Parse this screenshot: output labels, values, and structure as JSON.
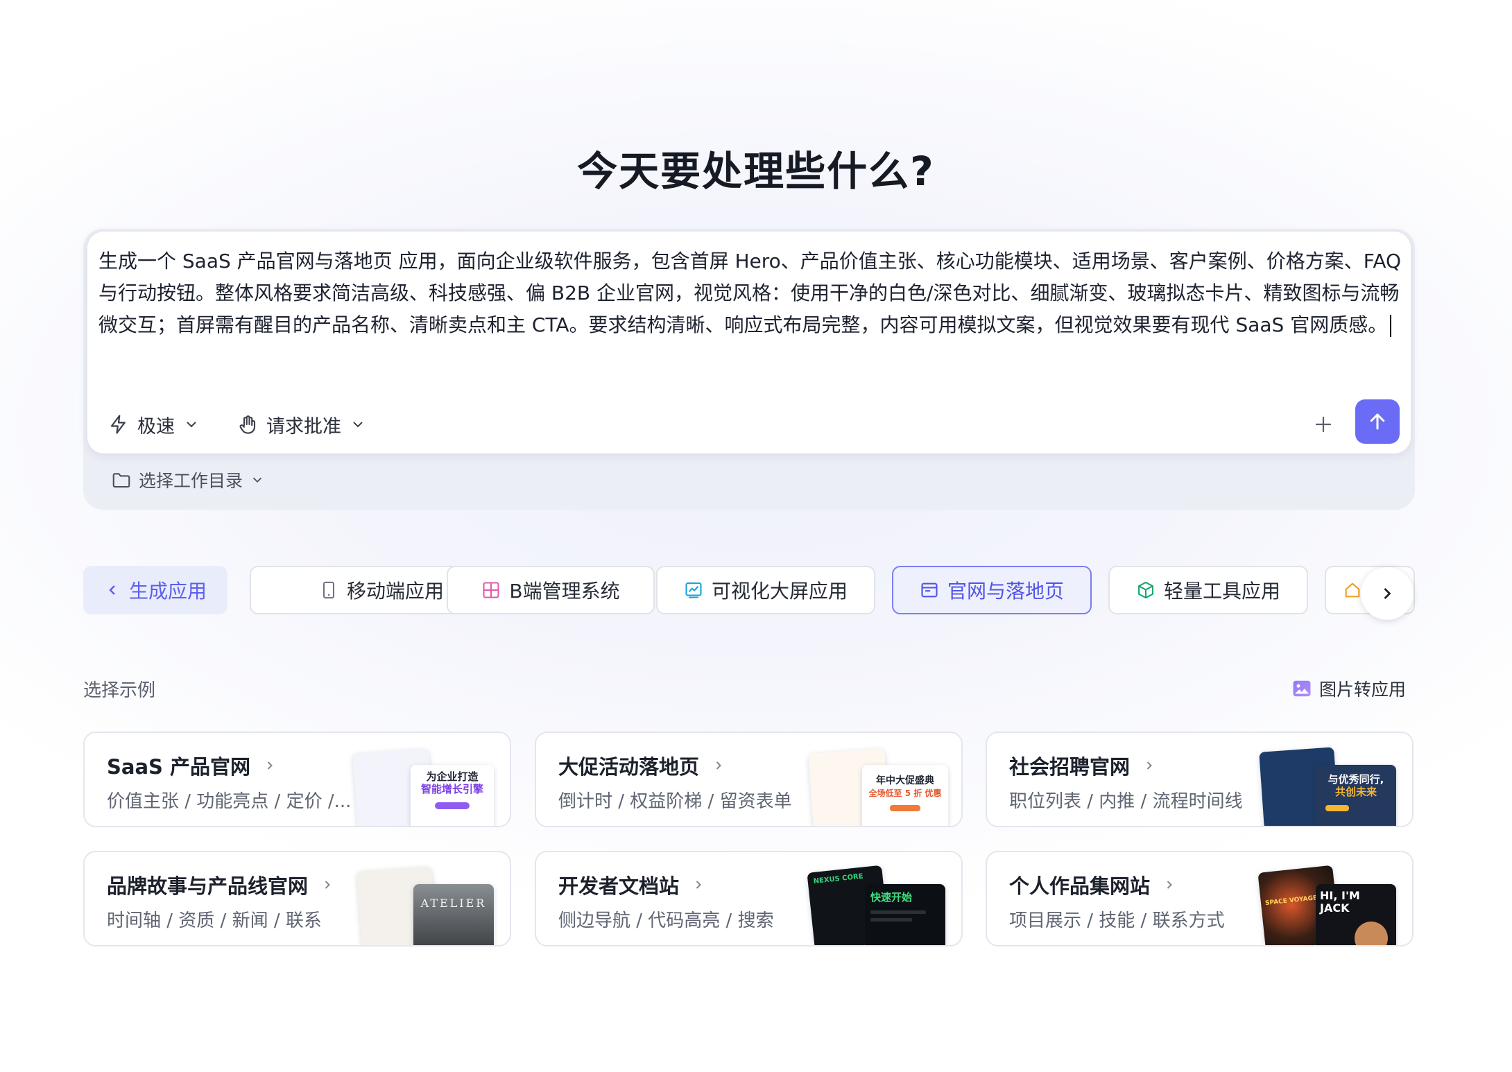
{
  "heading": "今天要处理些什么?",
  "composer": {
    "prompt": "生成一个 SaaS 产品官网与落地页 应用，面向企业级软件服务，包含首屏 Hero、产品价值主张、核心功能模块、适用场景、客户案例、价格方案、FAQ 与行动按钮。整体风格要求简洁高级、科技感强、偏 B2B 企业官网，视觉风格：使用干净的白色/深色对比、细腻渐变、玻璃拟态卡片、精致图标与流畅微交互；首屏需有醒目的产品名称、清晰卖点和主 CTA。要求结构清晰、响应式布局完整，内容可用模拟文案，但视觉效果要有现代 SaaS 官网质感。",
    "mode_label": "极速",
    "approval_label": "请求批准",
    "workdir_label": "选择工作目录"
  },
  "categories": [
    {
      "label": "生成应用",
      "icon": "chevron-left-icon"
    },
    {
      "label": "移动端应用",
      "icon": "mobile-icon"
    },
    {
      "label": "B端管理系统",
      "icon": "grid-icon"
    },
    {
      "label": "可视化大屏应用",
      "icon": "chart-icon"
    },
    {
      "label": "官网与落地页",
      "icon": "browser-window-icon",
      "active": true
    },
    {
      "label": "轻量工具应用",
      "icon": "cube-icon"
    }
  ],
  "examples_title": "选择示例",
  "image_to_app_label": "图片转应用",
  "examples": [
    {
      "title": "SaaS 产品官网",
      "subtitle": "价值主张 / 功能亮点 / 定价 /...",
      "thumb_text": "为企业打造",
      "thumb_text2": "智能增长引擎"
    },
    {
      "title": "大促活动落地页",
      "subtitle": "倒计时 / 权益阶梯 / 留资表单",
      "thumb_text": "年中大促盛典",
      "thumb_text2": "全场低至 5 折 优惠"
    },
    {
      "title": "社会招聘官网",
      "subtitle": "职位列表 / 内推 / 流程时间线",
      "thumb_text": "与优秀同行,",
      "thumb_text2": "共创未来"
    },
    {
      "title": "品牌故事与产品线官网",
      "subtitle": "时间轴 / 资质 / 新闻 / 联系",
      "thumb_text": "ATELIER",
      "thumb_text2": ""
    },
    {
      "title": "开发者文档站",
      "subtitle": "侧边导航 / 代码高亮 / 搜索",
      "thumb_text": "快速开始",
      "thumb_text2": "NEXUS CORE"
    },
    {
      "title": "个人作品集网站",
      "subtitle": "项目展示 / 技能 / 联系方式",
      "thumb_text": "HI, I'M JACK",
      "thumb_text2": "SPACE VOYAGER"
    }
  ],
  "colors": {
    "accent": "#6a6cf6",
    "active_text": "#4f53e6",
    "border": "#e1e3ea"
  }
}
